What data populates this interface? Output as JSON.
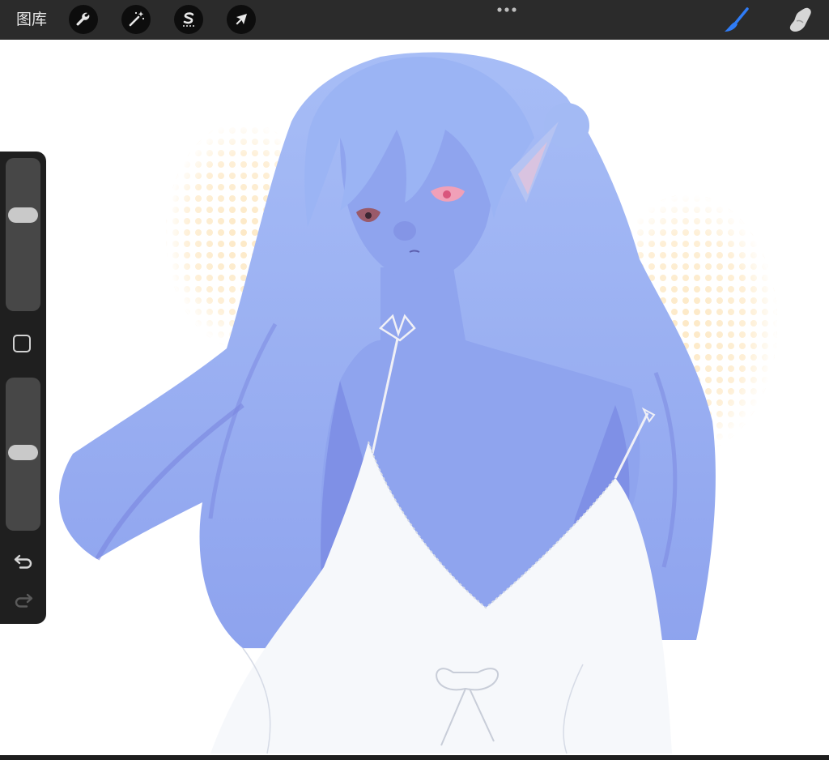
{
  "topbar": {
    "gallery_label": "图库",
    "tools": [
      {
        "name": "actions",
        "icon": "wrench-icon"
      },
      {
        "name": "adjustments",
        "icon": "magic-wand-icon"
      },
      {
        "name": "selection",
        "icon": "selection-s-icon"
      },
      {
        "name": "transform",
        "icon": "arrow-cursor-icon"
      }
    ],
    "more_icon": "ellipsis-icon",
    "right_tools": [
      {
        "name": "brush",
        "icon": "brush-icon",
        "active": true,
        "color": "#2f7cf6"
      },
      {
        "name": "smudge",
        "icon": "smudge-finger-icon",
        "active": false
      }
    ]
  },
  "sidebar": {
    "brush_size_level": 0.36,
    "opacity_level": 0.49,
    "modifier_icon": "square-modifier-icon",
    "undo_icon": "undo-icon",
    "redo_icon": "redo-icon"
  },
  "canvas": {
    "illustration": "anime-girl-blue-skin-white-dress",
    "colors": {
      "skin": "#8fa4ee",
      "hair": "#9bb4f4",
      "hair_shadow": "#7a86e0",
      "dress": "#f6f8fb",
      "halftone": "#fde9c6",
      "background": "#ffffff"
    }
  },
  "colors": {
    "toolbar_bg": "#2b2b2b",
    "sidebar_bg": "#1f1f1f",
    "accent": "#2f7cf6"
  }
}
